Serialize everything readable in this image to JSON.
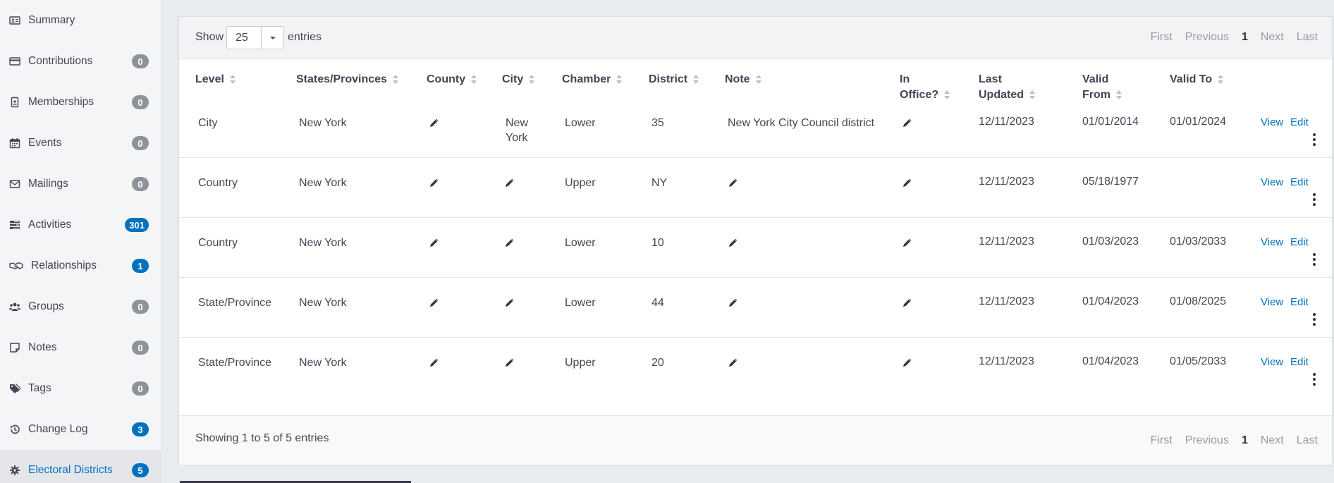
{
  "sidebar": {
    "items": [
      {
        "label": "Summary",
        "icon": "id-card-icon",
        "badge": null
      },
      {
        "label": "Contributions",
        "icon": "credit-card-icon",
        "badge": "0"
      },
      {
        "label": "Memberships",
        "icon": "id-badge-icon",
        "badge": "0"
      },
      {
        "label": "Events",
        "icon": "calendar-icon",
        "badge": "0"
      },
      {
        "label": "Mailings",
        "icon": "envelope-icon",
        "badge": "0"
      },
      {
        "label": "Activities",
        "icon": "tasks-icon",
        "badge": "301"
      },
      {
        "label": "Relationships",
        "icon": "handshake-icon",
        "badge": "1"
      },
      {
        "label": "Groups",
        "icon": "users-icon",
        "badge": "0"
      },
      {
        "label": "Notes",
        "icon": "sticky-note-icon",
        "badge": "0"
      },
      {
        "label": "Tags",
        "icon": "tags-icon",
        "badge": "0"
      },
      {
        "label": "Change Log",
        "icon": "history-icon",
        "badge": "3"
      },
      {
        "label": "Electoral Districts",
        "icon": "gear-icon",
        "badge": "5"
      }
    ],
    "active": "Electoral Districts"
  },
  "toolbar": {
    "show_label": "Show",
    "page_length": "25",
    "entries_label": "entries"
  },
  "pager": {
    "first": "First",
    "previous": "Previous",
    "current": "1",
    "next": "Next",
    "last": "Last"
  },
  "table": {
    "headers": {
      "level": "Level",
      "states": "States/Provinces",
      "county": "County",
      "city": "City",
      "chamber": "Chamber",
      "district": "District",
      "note": "Note",
      "in_office_1": "In",
      "in_office_2": "Office?",
      "last_updated_1": "Last",
      "last_updated_2": "Updated",
      "valid_from_1": "Valid",
      "valid_from_2": "From",
      "valid_to": "Valid To"
    },
    "rows": [
      {
        "level": "City",
        "state": "New York",
        "county": "",
        "city_1": "New",
        "city_2": "York",
        "chamber": "Lower",
        "district": "35",
        "note": "New York City Council district",
        "in_office": "",
        "last_updated": "12/11/2023",
        "valid_from": "01/01/2014",
        "valid_to": "01/01/2024",
        "view": "View",
        "edit": "Edit"
      },
      {
        "level": "Country",
        "state": "New York",
        "county": "",
        "city_1": "",
        "city_2": "",
        "chamber": "Upper",
        "district": "NY",
        "note": "",
        "in_office": "",
        "last_updated": "12/11/2023",
        "valid_from": "05/18/1977",
        "valid_to": "",
        "view": "View",
        "edit": "Edit"
      },
      {
        "level": "Country",
        "state": "New York",
        "county": "",
        "city_1": "",
        "city_2": "",
        "chamber": "Lower",
        "district": "10",
        "note": "",
        "in_office": "",
        "last_updated": "12/11/2023",
        "valid_from": "01/03/2023",
        "valid_to": "01/03/2033",
        "view": "View",
        "edit": "Edit"
      },
      {
        "level": "State/Province",
        "state": "New York",
        "county": "",
        "city_1": "",
        "city_2": "",
        "chamber": "Lower",
        "district": "44",
        "note": "",
        "in_office": "",
        "last_updated": "12/11/2023",
        "valid_from": "01/04/2023",
        "valid_to": "01/08/2025",
        "view": "View",
        "edit": "Edit"
      },
      {
        "level": "State/Province",
        "state": "New York",
        "county": "",
        "city_1": "",
        "city_2": "",
        "chamber": "Upper",
        "district": "20",
        "note": "",
        "in_office": "",
        "last_updated": "12/11/2023",
        "valid_from": "01/04/2023",
        "valid_to": "01/05/2033",
        "view": "View",
        "edit": "Edit"
      }
    ]
  },
  "footer": {
    "showing": "Showing 1 to 5 of 5 entries"
  },
  "colors": {
    "accent": "#0071bd",
    "badge_gray": "#8f929b"
  }
}
